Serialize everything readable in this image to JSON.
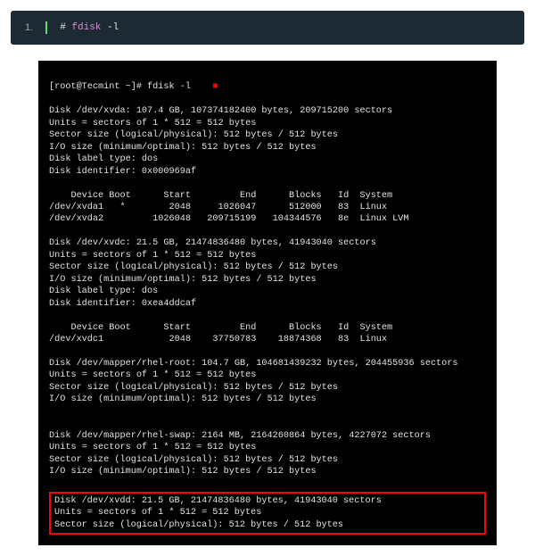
{
  "code_panel": {
    "line_number": "1.",
    "hash": "#",
    "command": "fdisk",
    "flag": "-l"
  },
  "terminal": {
    "prompt_line": "[root@Tecmint ~]# fdisk -l    ",
    "cursor_glyph": "■",
    "block_xvda": "Disk /dev/xvda: 107.4 GB, 107374182400 bytes, 209715200 sectors\nUnits = sectors of 1 * 512 = 512 bytes\nSector size (logical/physical): 512 bytes / 512 bytes\nI/O size (minimum/optimal): 512 bytes / 512 bytes\nDisk label type: dos\nDisk identifier: 0x000969af",
    "part_header1": "    Device Boot      Start         End      Blocks   Id  System",
    "part_xvda1": "/dev/xvda1   *        2048     1026047      512000   83  Linux",
    "part_xvda2": "/dev/xvda2         1026048   209715199   104344576   8e  Linux LVM",
    "block_xvdc": "Disk /dev/xvdc: 21.5 GB, 21474836480 bytes, 41943040 sectors\nUnits = sectors of 1 * 512 = 512 bytes\nSector size (logical/physical): 512 bytes / 512 bytes\nI/O size (minimum/optimal): 512 bytes / 512 bytes\nDisk label type: dos\nDisk identifier: 0xea4ddcaf",
    "part_header2": "    Device Boot      Start         End      Blocks   Id  System",
    "part_xvdc1": "/dev/xvdc1            2048    37750783    18874368   83  Linux",
    "block_rhelroot": "Disk /dev/mapper/rhel-root: 104.7 GB, 104681439232 bytes, 204455936 sectors\nUnits = sectors of 1 * 512 = 512 bytes\nSector size (logical/physical): 512 bytes / 512 bytes\nI/O size (minimum/optimal): 512 bytes / 512 bytes",
    "block_rhelswap": "Disk /dev/mapper/rhel-swap: 2164 MB, 2164260864 bytes, 4227072 sectors\nUnits = sectors of 1 * 512 = 512 bytes\nSector size (logical/physical): 512 bytes / 512 bytes\nI/O size (minimum/optimal): 512 bytes / 512 bytes",
    "highlighted": "Disk /dev/xvdd: 21.5 GB, 21474836480 bytes, 41943040 sectors\nUnits = sectors of 1 * 512 = 512 bytes\nSector size (logical/physical): 512 bytes / 512 bytes"
  }
}
